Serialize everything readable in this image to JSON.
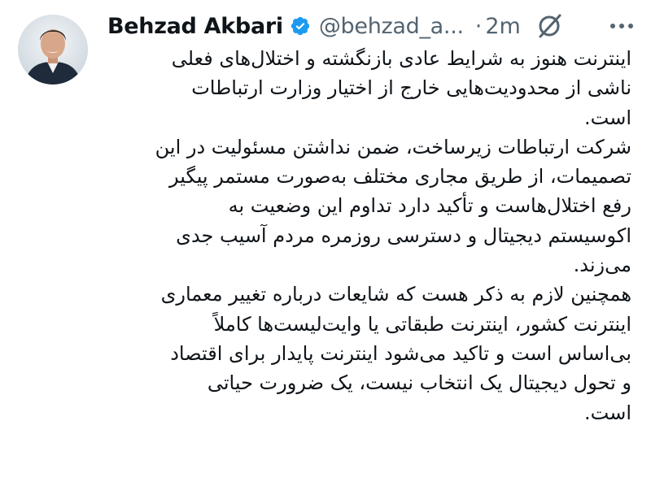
{
  "author": {
    "display_name": "Behzad Akbari",
    "handle": "@behzad_a...",
    "verified_icon": "verified-badge-icon",
    "verified_color": "#1d9bf0",
    "timestamp": "2m",
    "separator": "·"
  },
  "icons": {
    "grok": "grok-icon",
    "more": "more-options-icon"
  },
  "tweet": {
    "lines": [
      "اینترنت هنوز به شرایط عادی بازنگشته و اختلال‌های فعلی",
      "ناشی از محدودیت‌هایی خارج از اختیار وزارت ارتباطات",
      "است.",
      "شرکت ارتباطات زیرساخت، ضمن نداشتن مسئولیت در این",
      "تصمیمات، از طریق مجاری مختلف به‌صورت مستمر پیگیر",
      "رفع اختلال‌هاست و تأکید دارد تداوم این وضعیت به",
      "اکوسیستم دیجیتال و دسترسی روزمره مردم آسیب جدی",
      "می‌زند.",
      "همچنین لازم به ذکر هست که شایعات درباره تغییر معماری",
      "اینترنت کشور، اینترنت طبقاتی یا وایت‌لیست‌ها کاملاً",
      "بی‌اساس است و تاکید می‌شود اینترنت پایدار برای اقتصاد",
      "و تحول دیجیتال یک انتخاب نیست، یک ضرورت حیاتی",
      "است."
    ]
  }
}
